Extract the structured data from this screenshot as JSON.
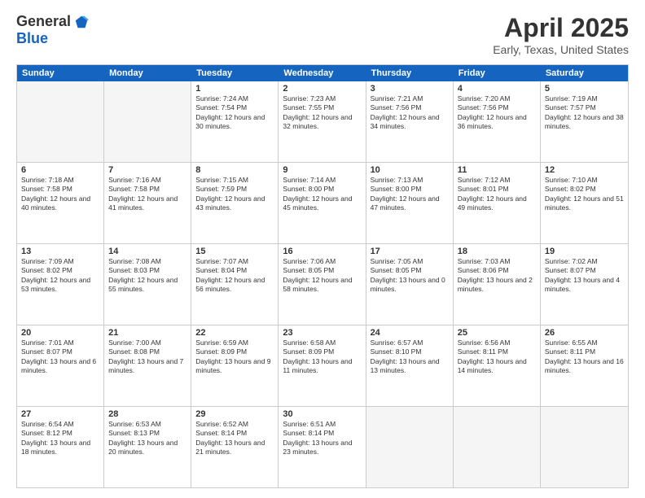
{
  "header": {
    "logo_general": "General",
    "logo_blue": "Blue",
    "month_title": "April 2025",
    "location": "Early, Texas, United States"
  },
  "days_of_week": [
    "Sunday",
    "Monday",
    "Tuesday",
    "Wednesday",
    "Thursday",
    "Friday",
    "Saturday"
  ],
  "weeks": [
    [
      {
        "day": "",
        "sunrise": "",
        "sunset": "",
        "daylight": "",
        "empty": true
      },
      {
        "day": "",
        "sunrise": "",
        "sunset": "",
        "daylight": "",
        "empty": true
      },
      {
        "day": "1",
        "sunrise": "Sunrise: 7:24 AM",
        "sunset": "Sunset: 7:54 PM",
        "daylight": "Daylight: 12 hours and 30 minutes.",
        "empty": false
      },
      {
        "day": "2",
        "sunrise": "Sunrise: 7:23 AM",
        "sunset": "Sunset: 7:55 PM",
        "daylight": "Daylight: 12 hours and 32 minutes.",
        "empty": false
      },
      {
        "day": "3",
        "sunrise": "Sunrise: 7:21 AM",
        "sunset": "Sunset: 7:56 PM",
        "daylight": "Daylight: 12 hours and 34 minutes.",
        "empty": false
      },
      {
        "day": "4",
        "sunrise": "Sunrise: 7:20 AM",
        "sunset": "Sunset: 7:56 PM",
        "daylight": "Daylight: 12 hours and 36 minutes.",
        "empty": false
      },
      {
        "day": "5",
        "sunrise": "Sunrise: 7:19 AM",
        "sunset": "Sunset: 7:57 PM",
        "daylight": "Daylight: 12 hours and 38 minutes.",
        "empty": false
      }
    ],
    [
      {
        "day": "6",
        "sunrise": "Sunrise: 7:18 AM",
        "sunset": "Sunset: 7:58 PM",
        "daylight": "Daylight: 12 hours and 40 minutes.",
        "empty": false
      },
      {
        "day": "7",
        "sunrise": "Sunrise: 7:16 AM",
        "sunset": "Sunset: 7:58 PM",
        "daylight": "Daylight: 12 hours and 41 minutes.",
        "empty": false
      },
      {
        "day": "8",
        "sunrise": "Sunrise: 7:15 AM",
        "sunset": "Sunset: 7:59 PM",
        "daylight": "Daylight: 12 hours and 43 minutes.",
        "empty": false
      },
      {
        "day": "9",
        "sunrise": "Sunrise: 7:14 AM",
        "sunset": "Sunset: 8:00 PM",
        "daylight": "Daylight: 12 hours and 45 minutes.",
        "empty": false
      },
      {
        "day": "10",
        "sunrise": "Sunrise: 7:13 AM",
        "sunset": "Sunset: 8:00 PM",
        "daylight": "Daylight: 12 hours and 47 minutes.",
        "empty": false
      },
      {
        "day": "11",
        "sunrise": "Sunrise: 7:12 AM",
        "sunset": "Sunset: 8:01 PM",
        "daylight": "Daylight: 12 hours and 49 minutes.",
        "empty": false
      },
      {
        "day": "12",
        "sunrise": "Sunrise: 7:10 AM",
        "sunset": "Sunset: 8:02 PM",
        "daylight": "Daylight: 12 hours and 51 minutes.",
        "empty": false
      }
    ],
    [
      {
        "day": "13",
        "sunrise": "Sunrise: 7:09 AM",
        "sunset": "Sunset: 8:02 PM",
        "daylight": "Daylight: 12 hours and 53 minutes.",
        "empty": false
      },
      {
        "day": "14",
        "sunrise": "Sunrise: 7:08 AM",
        "sunset": "Sunset: 8:03 PM",
        "daylight": "Daylight: 12 hours and 55 minutes.",
        "empty": false
      },
      {
        "day": "15",
        "sunrise": "Sunrise: 7:07 AM",
        "sunset": "Sunset: 8:04 PM",
        "daylight": "Daylight: 12 hours and 56 minutes.",
        "empty": false
      },
      {
        "day": "16",
        "sunrise": "Sunrise: 7:06 AM",
        "sunset": "Sunset: 8:05 PM",
        "daylight": "Daylight: 12 hours and 58 minutes.",
        "empty": false
      },
      {
        "day": "17",
        "sunrise": "Sunrise: 7:05 AM",
        "sunset": "Sunset: 8:05 PM",
        "daylight": "Daylight: 13 hours and 0 minutes.",
        "empty": false
      },
      {
        "day": "18",
        "sunrise": "Sunrise: 7:03 AM",
        "sunset": "Sunset: 8:06 PM",
        "daylight": "Daylight: 13 hours and 2 minutes.",
        "empty": false
      },
      {
        "day": "19",
        "sunrise": "Sunrise: 7:02 AM",
        "sunset": "Sunset: 8:07 PM",
        "daylight": "Daylight: 13 hours and 4 minutes.",
        "empty": false
      }
    ],
    [
      {
        "day": "20",
        "sunrise": "Sunrise: 7:01 AM",
        "sunset": "Sunset: 8:07 PM",
        "daylight": "Daylight: 13 hours and 6 minutes.",
        "empty": false
      },
      {
        "day": "21",
        "sunrise": "Sunrise: 7:00 AM",
        "sunset": "Sunset: 8:08 PM",
        "daylight": "Daylight: 13 hours and 7 minutes.",
        "empty": false
      },
      {
        "day": "22",
        "sunrise": "Sunrise: 6:59 AM",
        "sunset": "Sunset: 8:09 PM",
        "daylight": "Daylight: 13 hours and 9 minutes.",
        "empty": false
      },
      {
        "day": "23",
        "sunrise": "Sunrise: 6:58 AM",
        "sunset": "Sunset: 8:09 PM",
        "daylight": "Daylight: 13 hours and 11 minutes.",
        "empty": false
      },
      {
        "day": "24",
        "sunrise": "Sunrise: 6:57 AM",
        "sunset": "Sunset: 8:10 PM",
        "daylight": "Daylight: 13 hours and 13 minutes.",
        "empty": false
      },
      {
        "day": "25",
        "sunrise": "Sunrise: 6:56 AM",
        "sunset": "Sunset: 8:11 PM",
        "daylight": "Daylight: 13 hours and 14 minutes.",
        "empty": false
      },
      {
        "day": "26",
        "sunrise": "Sunrise: 6:55 AM",
        "sunset": "Sunset: 8:11 PM",
        "daylight": "Daylight: 13 hours and 16 minutes.",
        "empty": false
      }
    ],
    [
      {
        "day": "27",
        "sunrise": "Sunrise: 6:54 AM",
        "sunset": "Sunset: 8:12 PM",
        "daylight": "Daylight: 13 hours and 18 minutes.",
        "empty": false
      },
      {
        "day": "28",
        "sunrise": "Sunrise: 6:53 AM",
        "sunset": "Sunset: 8:13 PM",
        "daylight": "Daylight: 13 hours and 20 minutes.",
        "empty": false
      },
      {
        "day": "29",
        "sunrise": "Sunrise: 6:52 AM",
        "sunset": "Sunset: 8:14 PM",
        "daylight": "Daylight: 13 hours and 21 minutes.",
        "empty": false
      },
      {
        "day": "30",
        "sunrise": "Sunrise: 6:51 AM",
        "sunset": "Sunset: 8:14 PM",
        "daylight": "Daylight: 13 hours and 23 minutes.",
        "empty": false
      },
      {
        "day": "",
        "sunrise": "",
        "sunset": "",
        "daylight": "",
        "empty": true
      },
      {
        "day": "",
        "sunrise": "",
        "sunset": "",
        "daylight": "",
        "empty": true
      },
      {
        "day": "",
        "sunrise": "",
        "sunset": "",
        "daylight": "",
        "empty": true
      }
    ]
  ]
}
